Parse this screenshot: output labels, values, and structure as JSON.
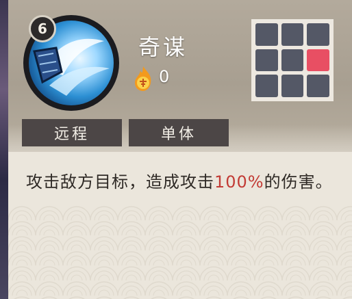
{
  "skill": {
    "level": "6",
    "name": "奇谋",
    "cost_value": "0",
    "cost_icon": "fire-orb-icon"
  },
  "tags": [
    "远程",
    "单体"
  ],
  "target_grid": {
    "rows": 3,
    "cols": 3,
    "active_row": 2,
    "active_col": 3
  },
  "description": {
    "prefix": "攻击敌方目标，造成攻击",
    "highlight": "100%",
    "suffix": "的伤害。"
  },
  "colors": {
    "highlight": "#c23b35",
    "grid_active": "#e84f63",
    "grid_inactive": "#545866"
  }
}
